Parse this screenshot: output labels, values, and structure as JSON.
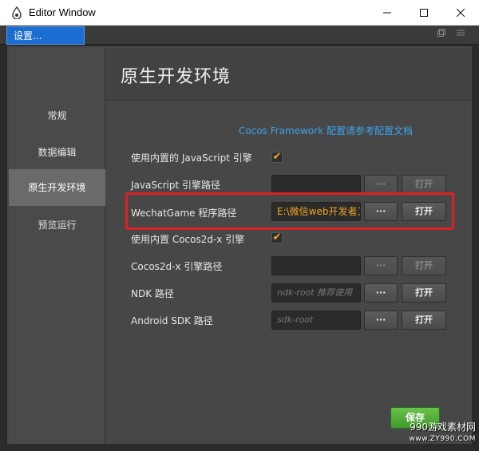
{
  "window": {
    "title": "Editor Window"
  },
  "tab": {
    "label": "设置..."
  },
  "sidebar": {
    "items": [
      {
        "label": "常规"
      },
      {
        "label": "数据编辑"
      },
      {
        "label": "原生开发环境",
        "active": true
      },
      {
        "label": "预览运行"
      }
    ]
  },
  "content": {
    "title": "原生开发环境",
    "link_text": "Cocos Framework 配置请参考配置文档",
    "rows": {
      "builtin_js": {
        "label": "使用内置的 JavaScript 引擎",
        "checked": true
      },
      "js_path": {
        "label": "JavaScript 引擎路径",
        "value": "",
        "dots": "···",
        "open": "打开"
      },
      "wechat_path": {
        "label": "WechatGame 程序路径",
        "value": "E:\\微信web开发者工具",
        "dots": "···",
        "open": "打开"
      },
      "builtin_cocos": {
        "label": "使用内置 Cocos2d-x 引擎",
        "checked": true
      },
      "cocos_path": {
        "label": "Cocos2d-x 引擎路径",
        "value": "",
        "dots": "···",
        "open": "打开"
      },
      "ndk_path": {
        "label": "NDK 路径",
        "placeholder": "ndk-root 推荐使用",
        "dots": "···",
        "open": "打开"
      },
      "sdk_path": {
        "label": "Android SDK 路径",
        "placeholder": "sdk-root",
        "dots": "···",
        "open": "打开"
      }
    },
    "save_label": "保存"
  },
  "watermark": {
    "line1": "990游戏素材网",
    "line2": "www.ZY990.COM"
  },
  "colors": {
    "accent": "#f5a623",
    "link": "#3ea2ea",
    "highlight": "#e02020",
    "save": "#4caf33"
  }
}
